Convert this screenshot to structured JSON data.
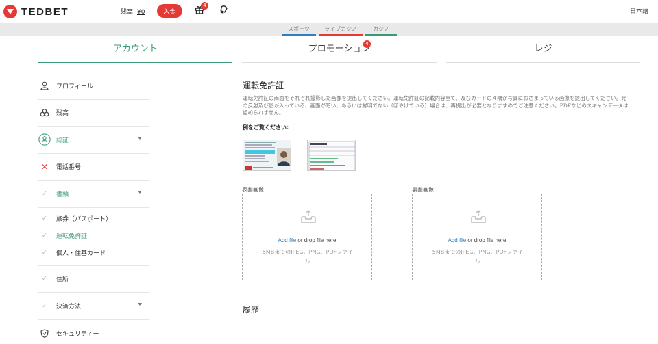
{
  "header": {
    "brand": "TEDBET",
    "balance_label": "残高:",
    "balance_value": "¥0",
    "deposit_label": "入金",
    "gift_badge": "4",
    "language": "日本語"
  },
  "subnav": [
    {
      "label": "スポーツ",
      "color": "#2f7fc0"
    },
    {
      "label": "ライブカジノ",
      "color": "#e53935"
    },
    {
      "label": "カジノ",
      "color": "#3a9a74"
    }
  ],
  "tabs": [
    {
      "label": "アカウント",
      "active": true
    },
    {
      "label": "プロモーション",
      "badge": "4"
    },
    {
      "label": "レジ"
    }
  ],
  "sidebar": {
    "profile": "プロフィール",
    "balance": "残高",
    "verification": "認証",
    "phone": "電話番号",
    "documents": "書類",
    "doc_passport": "旅券（パスポート）",
    "doc_license": "運転免許証",
    "doc_personal": "個人・住基カード",
    "address": "住所",
    "payment": "決済方法",
    "security": "セキュリティー"
  },
  "main": {
    "title": "運転免許証",
    "description": "運転免許証の両面をそれぞれ撮影した画像を提出してください。運転免許証の記載内容全て、及びカードの４隅が写真におさまっている画像を提出してください。光の反射及び影が入っている、画面が暗い、あるいは鮮明でない（ぼやけている）場合は、再提出が必要となりますのでご注意ください。PDFなどのスキャンデータは認められません。",
    "example_label": "例をご覧ください:",
    "front_label": "表面画像:",
    "back_label": "裏面画像:",
    "add_file": "Add file",
    "drop_text": " or drop file here",
    "hint": "5MBまでのJPEG、PNG、PDFファイル",
    "history": "履歴"
  },
  "colors": {
    "accent_red": "#e53935",
    "accent_green": "#3a9a74",
    "link_blue": "#2f7fc0"
  }
}
